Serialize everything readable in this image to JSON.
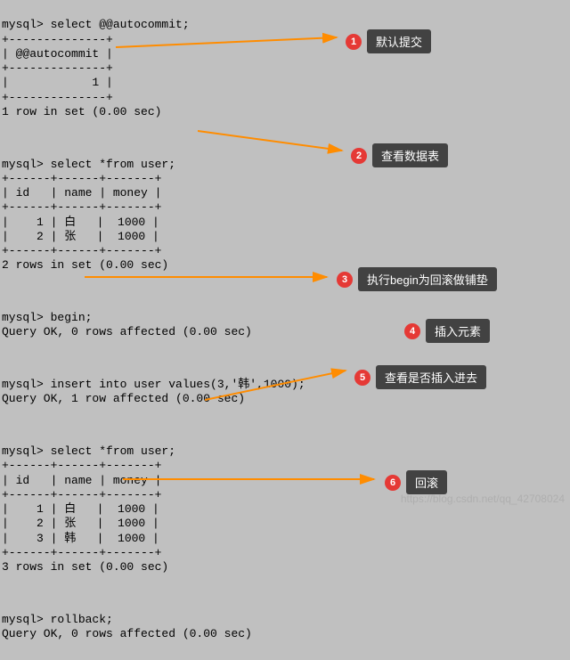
{
  "terminal": {
    "block1": "mysql> select @@autocommit;\n+--------------+\n| @@autocommit |\n+--------------+\n|            1 |\n+--------------+\n1 row in set (0.00 sec)",
    "block2": "mysql> select *from user;\n+------+------+-------+\n| id   | name | money |\n+------+------+-------+\n|    1 | 白   |  1000 |\n|    2 | 张   |  1000 |\n+------+------+-------+\n2 rows in set (0.00 sec)",
    "block3": "mysql> begin;\nQuery OK, 0 rows affected (0.00 sec)",
    "block4": "mysql> insert into user values(3,'韩',1000);\nQuery OK, 1 row affected (0.00 sec)",
    "block5": "mysql> select *from user;\n+------+------+-------+\n| id   | name | money |\n+------+------+-------+\n|    1 | 白   |  1000 |\n|    2 | 张   |  1000 |\n|    3 | 韩   |  1000 |\n+------+------+-------+\n3 rows in set (0.00 sec)",
    "block6": "mysql> rollback;\nQuery OK, 0 rows affected (0.00 sec)"
  },
  "callouts": {
    "c1": {
      "num": "1",
      "text": "默认提交"
    },
    "c2": {
      "num": "2",
      "text": "查看数据表"
    },
    "c3": {
      "num": "3",
      "text": "执行begin为回滚做铺垫"
    },
    "c4": {
      "num": "4",
      "text": "插入元素"
    },
    "c5": {
      "num": "5",
      "text": "查看是否插入进去"
    },
    "c6": {
      "num": "6",
      "text": "回滚"
    }
  },
  "watermark": "https://blog.csdn.net/qq_42708024"
}
